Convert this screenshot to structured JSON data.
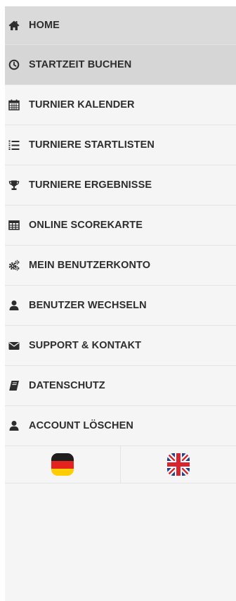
{
  "menu": {
    "items": [
      {
        "label": "HOME",
        "icon": "home-icon"
      },
      {
        "label": "STARTZEIT BUCHEN",
        "icon": "clock-icon"
      },
      {
        "label": "TURNIER KALENDER",
        "icon": "calendar-icon"
      },
      {
        "label": "TURNIERE STARTLISTEN",
        "icon": "list-icon"
      },
      {
        "label": "TURNIERE ERGEBNISSE",
        "icon": "trophy-icon"
      },
      {
        "label": "ONLINE SCOREKARTE",
        "icon": "table-icon"
      },
      {
        "label": "MEIN BENUTZERKONTO",
        "icon": "gears-icon"
      },
      {
        "label": "BENUTZER WECHSELN",
        "icon": "user-icon"
      },
      {
        "label": "SUPPORT & KONTAKT",
        "icon": "envelope-icon"
      },
      {
        "label": "DATENSCHUTZ",
        "icon": "book-icon"
      },
      {
        "label": "ACCOUNT LÖSCHEN",
        "icon": "user-icon"
      }
    ]
  },
  "languages": [
    {
      "icon": "german-flag-icon"
    },
    {
      "icon": "uk-flag-icon"
    }
  ],
  "colors": {
    "panel_bg": "#f5f5f5",
    "active_bg": "#d6d6d6",
    "text": "#2d2d2d",
    "divider": "#e4e4e4"
  }
}
